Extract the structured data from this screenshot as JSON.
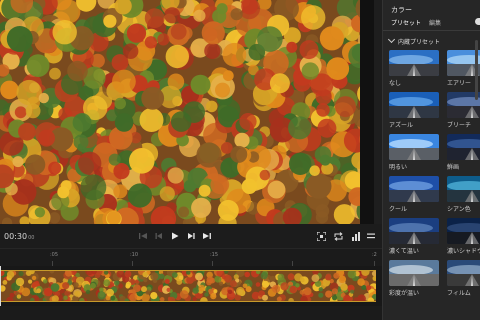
{
  "panel": {
    "title": "カラー",
    "tabs": [
      "プリセット",
      "編集"
    ],
    "section_title": "内蔵プリセット",
    "presets": [
      {
        "label": "なし"
      },
      {
        "label": "エアリー"
      },
      {
        "label": "アズール"
      },
      {
        "label": "ブリーチ"
      },
      {
        "label": "明るい"
      },
      {
        "label": "鮮画"
      },
      {
        "label": "クール"
      },
      {
        "label": "シアン色"
      },
      {
        "label": "濃くて温い"
      },
      {
        "label": "濃いシャドウ"
      },
      {
        "label": "彩度が温い"
      },
      {
        "label": "フィルム"
      }
    ]
  },
  "player": {
    "timecode": "00:30",
    "timecode_frames": "00"
  },
  "timeline": {
    "ruler_labels": [
      ":05",
      ":10",
      ":15",
      ":2"
    ]
  },
  "icons": {
    "prev_frame": "skip-back-icon",
    "step_back": "step-back-icon",
    "play": "play-icon",
    "step_forward": "step-forward-icon",
    "next_frame": "skip-forward-icon",
    "fit": "fit-screen-icon",
    "loop": "loop-icon",
    "audio": "volume-icon",
    "menu": "menu-icon"
  }
}
